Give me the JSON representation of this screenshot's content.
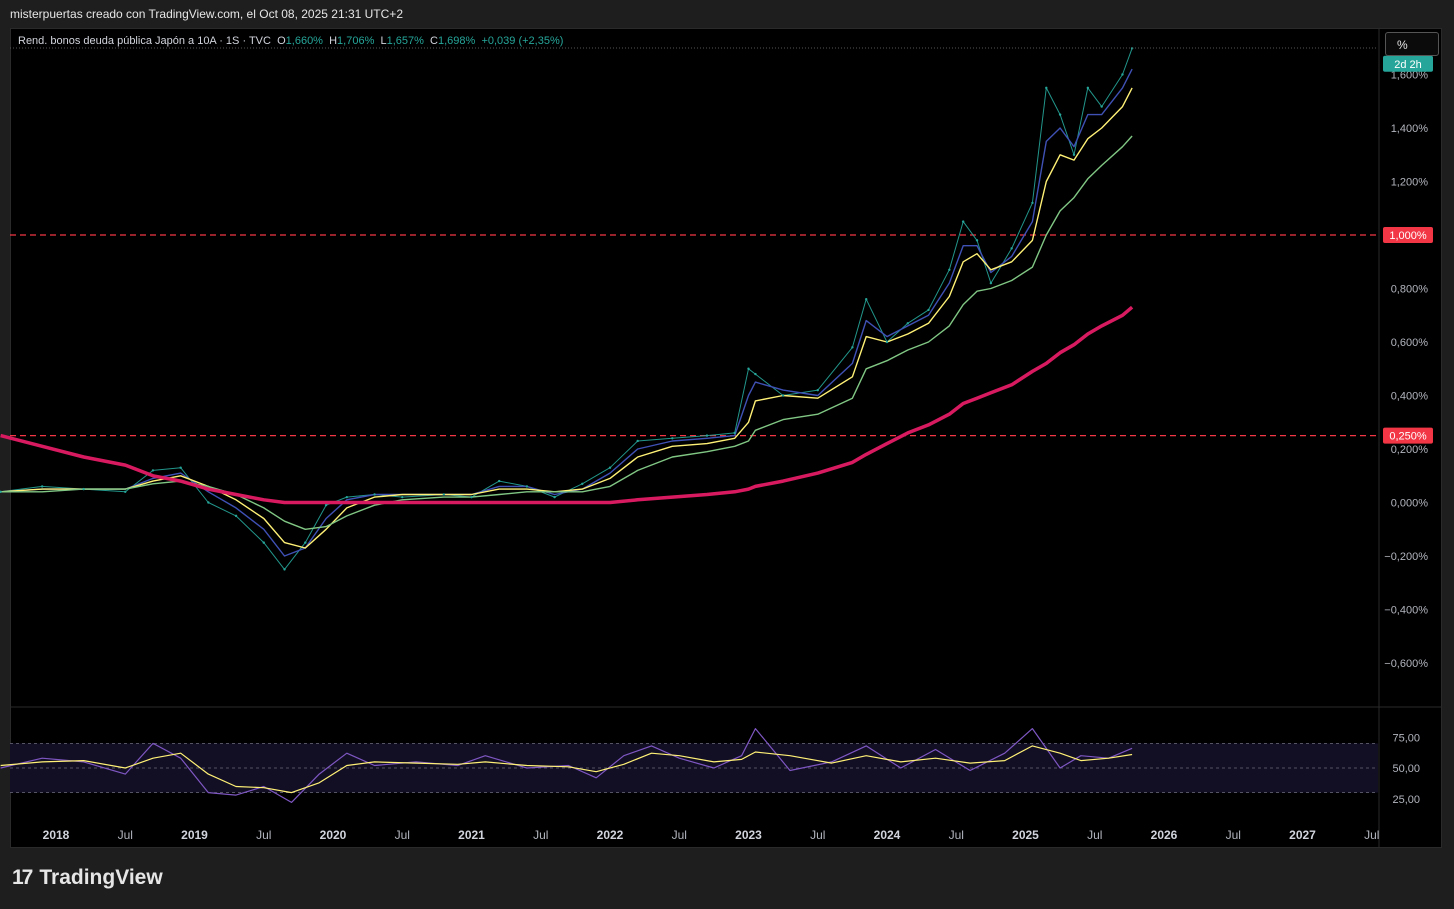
{
  "header": {
    "attribution": "misterpuertas creado con TradingView.com, el Oct 08, 2025 21:31 UTC+2"
  },
  "legend": {
    "symbol": "Rend. bonos deuda pública Japón a 10A · 1S · TVC",
    "open_label": "O",
    "open": "1,660%",
    "high_label": "H",
    "high": "1,706%",
    "low_label": "L",
    "low": "1,657%",
    "close_label": "C",
    "close": "1,698%",
    "change": "+0,039 (+2,35%)"
  },
  "scale_button": "%",
  "brand": {
    "logo": "17",
    "name": "TradingView"
  },
  "price_badges": [
    {
      "label": "2d 2h",
      "color": "#26a69a"
    },
    {
      "label": "1,000%",
      "color": "#f23645"
    },
    {
      "label": "0,250%",
      "color": "#f23645"
    }
  ],
  "chart_data": [
    {
      "type": "line",
      "title": "Rend. bonos deuda pública Japón a 10A · 1S · TVC",
      "ylabel": "%",
      "ylim": [
        -0.7,
        1.7
      ],
      "y_ticks": [
        "1,600%",
        "1,400%",
        "1,200%",
        "0,800%",
        "0,600%",
        "0,400%",
        "0,200%",
        "0,000%",
        "−0,200%",
        "−0,400%",
        "−0,600%"
      ],
      "x_ticks": [
        "2018",
        "Jul",
        "2019",
        "Jul",
        "2020",
        "Jul",
        "2021",
        "Jul",
        "2022",
        "Jul",
        "2023",
        "Jul",
        "2024",
        "Jul",
        "2025",
        "Jul",
        "2026",
        "Jul",
        "2027",
        "Jul"
      ],
      "x_bold": [
        "2018",
        "2019",
        "2020",
        "2021",
        "2022",
        "2023",
        "2024",
        "2025",
        "2026",
        "2027"
      ],
      "horizontal_lines": [
        {
          "value": 1.0,
          "color": "#f23645",
          "style": "dashed"
        },
        {
          "value": 0.25,
          "color": "#f23645",
          "style": "dashed"
        }
      ],
      "x": [
        2017.6,
        2017.9,
        2018.2,
        2018.5,
        2018.7,
        2018.9,
        2019.1,
        2019.3,
        2019.5,
        2019.65,
        2019.8,
        2019.95,
        2020.1,
        2020.3,
        2020.5,
        2020.8,
        2021.0,
        2021.2,
        2021.4,
        2021.6,
        2021.8,
        2022.0,
        2022.2,
        2022.45,
        2022.7,
        2022.9,
        2023.0,
        2023.05,
        2023.25,
        2023.5,
        2023.75,
        2023.85,
        2024.0,
        2024.15,
        2024.3,
        2024.45,
        2024.55,
        2024.65,
        2024.75,
        2024.9,
        2025.05,
        2025.15,
        2025.25,
        2025.35,
        2025.45,
        2025.55,
        2025.7,
        2025.77
      ],
      "series": [
        {
          "color": "#26a69a",
          "values": [
            0.04,
            0.06,
            0.05,
            0.04,
            0.12,
            0.13,
            0.0,
            -0.05,
            -0.15,
            -0.25,
            -0.15,
            -0.01,
            0.02,
            0.03,
            0.02,
            0.03,
            0.02,
            0.08,
            0.06,
            0.02,
            0.07,
            0.13,
            0.23,
            0.24,
            0.25,
            0.26,
            0.5,
            0.48,
            0.4,
            0.42,
            0.58,
            0.76,
            0.6,
            0.67,
            0.72,
            0.87,
            1.05,
            0.98,
            0.82,
            0.95,
            1.12,
            1.55,
            1.45,
            1.3,
            1.55,
            1.48,
            1.6,
            1.698
          ]
        },
        {
          "color": "#3f51b5",
          "values": [
            0.04,
            0.05,
            0.05,
            0.05,
            0.09,
            0.11,
            0.04,
            -0.02,
            -0.1,
            -0.2,
            -0.17,
            -0.06,
            0.01,
            0.03,
            0.03,
            0.03,
            0.03,
            0.06,
            0.06,
            0.03,
            0.05,
            0.11,
            0.2,
            0.23,
            0.24,
            0.25,
            0.4,
            0.45,
            0.42,
            0.4,
            0.52,
            0.68,
            0.62,
            0.66,
            0.7,
            0.82,
            0.96,
            0.96,
            0.86,
            0.92,
            1.05,
            1.35,
            1.4,
            1.33,
            1.45,
            1.45,
            1.55,
            1.62
          ]
        },
        {
          "color": "#fff176",
          "values": [
            0.04,
            0.05,
            0.05,
            0.05,
            0.08,
            0.1,
            0.06,
            0.01,
            -0.06,
            -0.15,
            -0.17,
            -0.1,
            -0.02,
            0.02,
            0.03,
            0.03,
            0.03,
            0.05,
            0.05,
            0.04,
            0.05,
            0.09,
            0.17,
            0.21,
            0.22,
            0.24,
            0.3,
            0.38,
            0.4,
            0.39,
            0.47,
            0.62,
            0.6,
            0.63,
            0.67,
            0.77,
            0.9,
            0.93,
            0.87,
            0.9,
            0.98,
            1.2,
            1.3,
            1.28,
            1.36,
            1.4,
            1.48,
            1.55
          ]
        },
        {
          "color": "#81c784",
          "values": [
            0.04,
            0.04,
            0.05,
            0.05,
            0.07,
            0.08,
            0.06,
            0.03,
            -0.02,
            -0.07,
            -0.1,
            -0.09,
            -0.05,
            -0.01,
            0.01,
            0.02,
            0.02,
            0.03,
            0.04,
            0.04,
            0.04,
            0.06,
            0.12,
            0.17,
            0.19,
            0.21,
            0.23,
            0.27,
            0.31,
            0.33,
            0.39,
            0.5,
            0.53,
            0.57,
            0.6,
            0.66,
            0.74,
            0.79,
            0.8,
            0.83,
            0.88,
            1.0,
            1.09,
            1.14,
            1.21,
            1.26,
            1.33,
            1.37
          ]
        },
        {
          "color": "#d81b60",
          "values": [
            0.25,
            0.21,
            0.17,
            0.14,
            0.1,
            0.08,
            0.05,
            0.03,
            0.01,
            0.0,
            0.0,
            0.0,
            0.0,
            0.0,
            0.0,
            0.0,
            0.0,
            0.0,
            0.0,
            0.0,
            0.0,
            0.0,
            0.01,
            0.02,
            0.03,
            0.04,
            0.05,
            0.06,
            0.08,
            0.11,
            0.15,
            0.18,
            0.22,
            0.26,
            0.29,
            0.33,
            0.37,
            0.39,
            0.41,
            0.44,
            0.49,
            0.52,
            0.56,
            0.59,
            0.63,
            0.66,
            0.7,
            0.73
          ]
        }
      ]
    },
    {
      "type": "line",
      "ylim": [
        20,
        85
      ],
      "y_ticks": [
        "75,00",
        "50,00",
        "25,00"
      ],
      "bands": [
        30,
        50,
        70
      ],
      "x": [
        2017.6,
        2017.9,
        2018.2,
        2018.5,
        2018.7,
        2018.9,
        2019.1,
        2019.3,
        2019.5,
        2019.7,
        2019.9,
        2020.1,
        2020.3,
        2020.6,
        2020.9,
        2021.1,
        2021.4,
        2021.7,
        2021.9,
        2022.1,
        2022.3,
        2022.5,
        2022.75,
        2022.95,
        2023.05,
        2023.3,
        2023.6,
        2023.85,
        2024.1,
        2024.35,
        2024.6,
        2024.85,
        2025.05,
        2025.25,
        2025.4,
        2025.6,
        2025.77
      ],
      "series": [
        {
          "color": "#7e57c2",
          "values": [
            50,
            58,
            55,
            45,
            70,
            58,
            30,
            28,
            35,
            22,
            45,
            62,
            52,
            55,
            52,
            60,
            50,
            52,
            42,
            60,
            68,
            58,
            50,
            60,
            82,
            48,
            55,
            68,
            50,
            65,
            48,
            62,
            82,
            50,
            60,
            58,
            66
          ]
        },
        {
          "color": "#fff176",
          "values": [
            52,
            55,
            56,
            50,
            58,
            62,
            45,
            35,
            34,
            30,
            38,
            52,
            55,
            54,
            53,
            55,
            52,
            51,
            47,
            53,
            62,
            60,
            55,
            57,
            63,
            60,
            54,
            60,
            55,
            58,
            54,
            56,
            68,
            62,
            56,
            58,
            61
          ]
        }
      ]
    }
  ]
}
